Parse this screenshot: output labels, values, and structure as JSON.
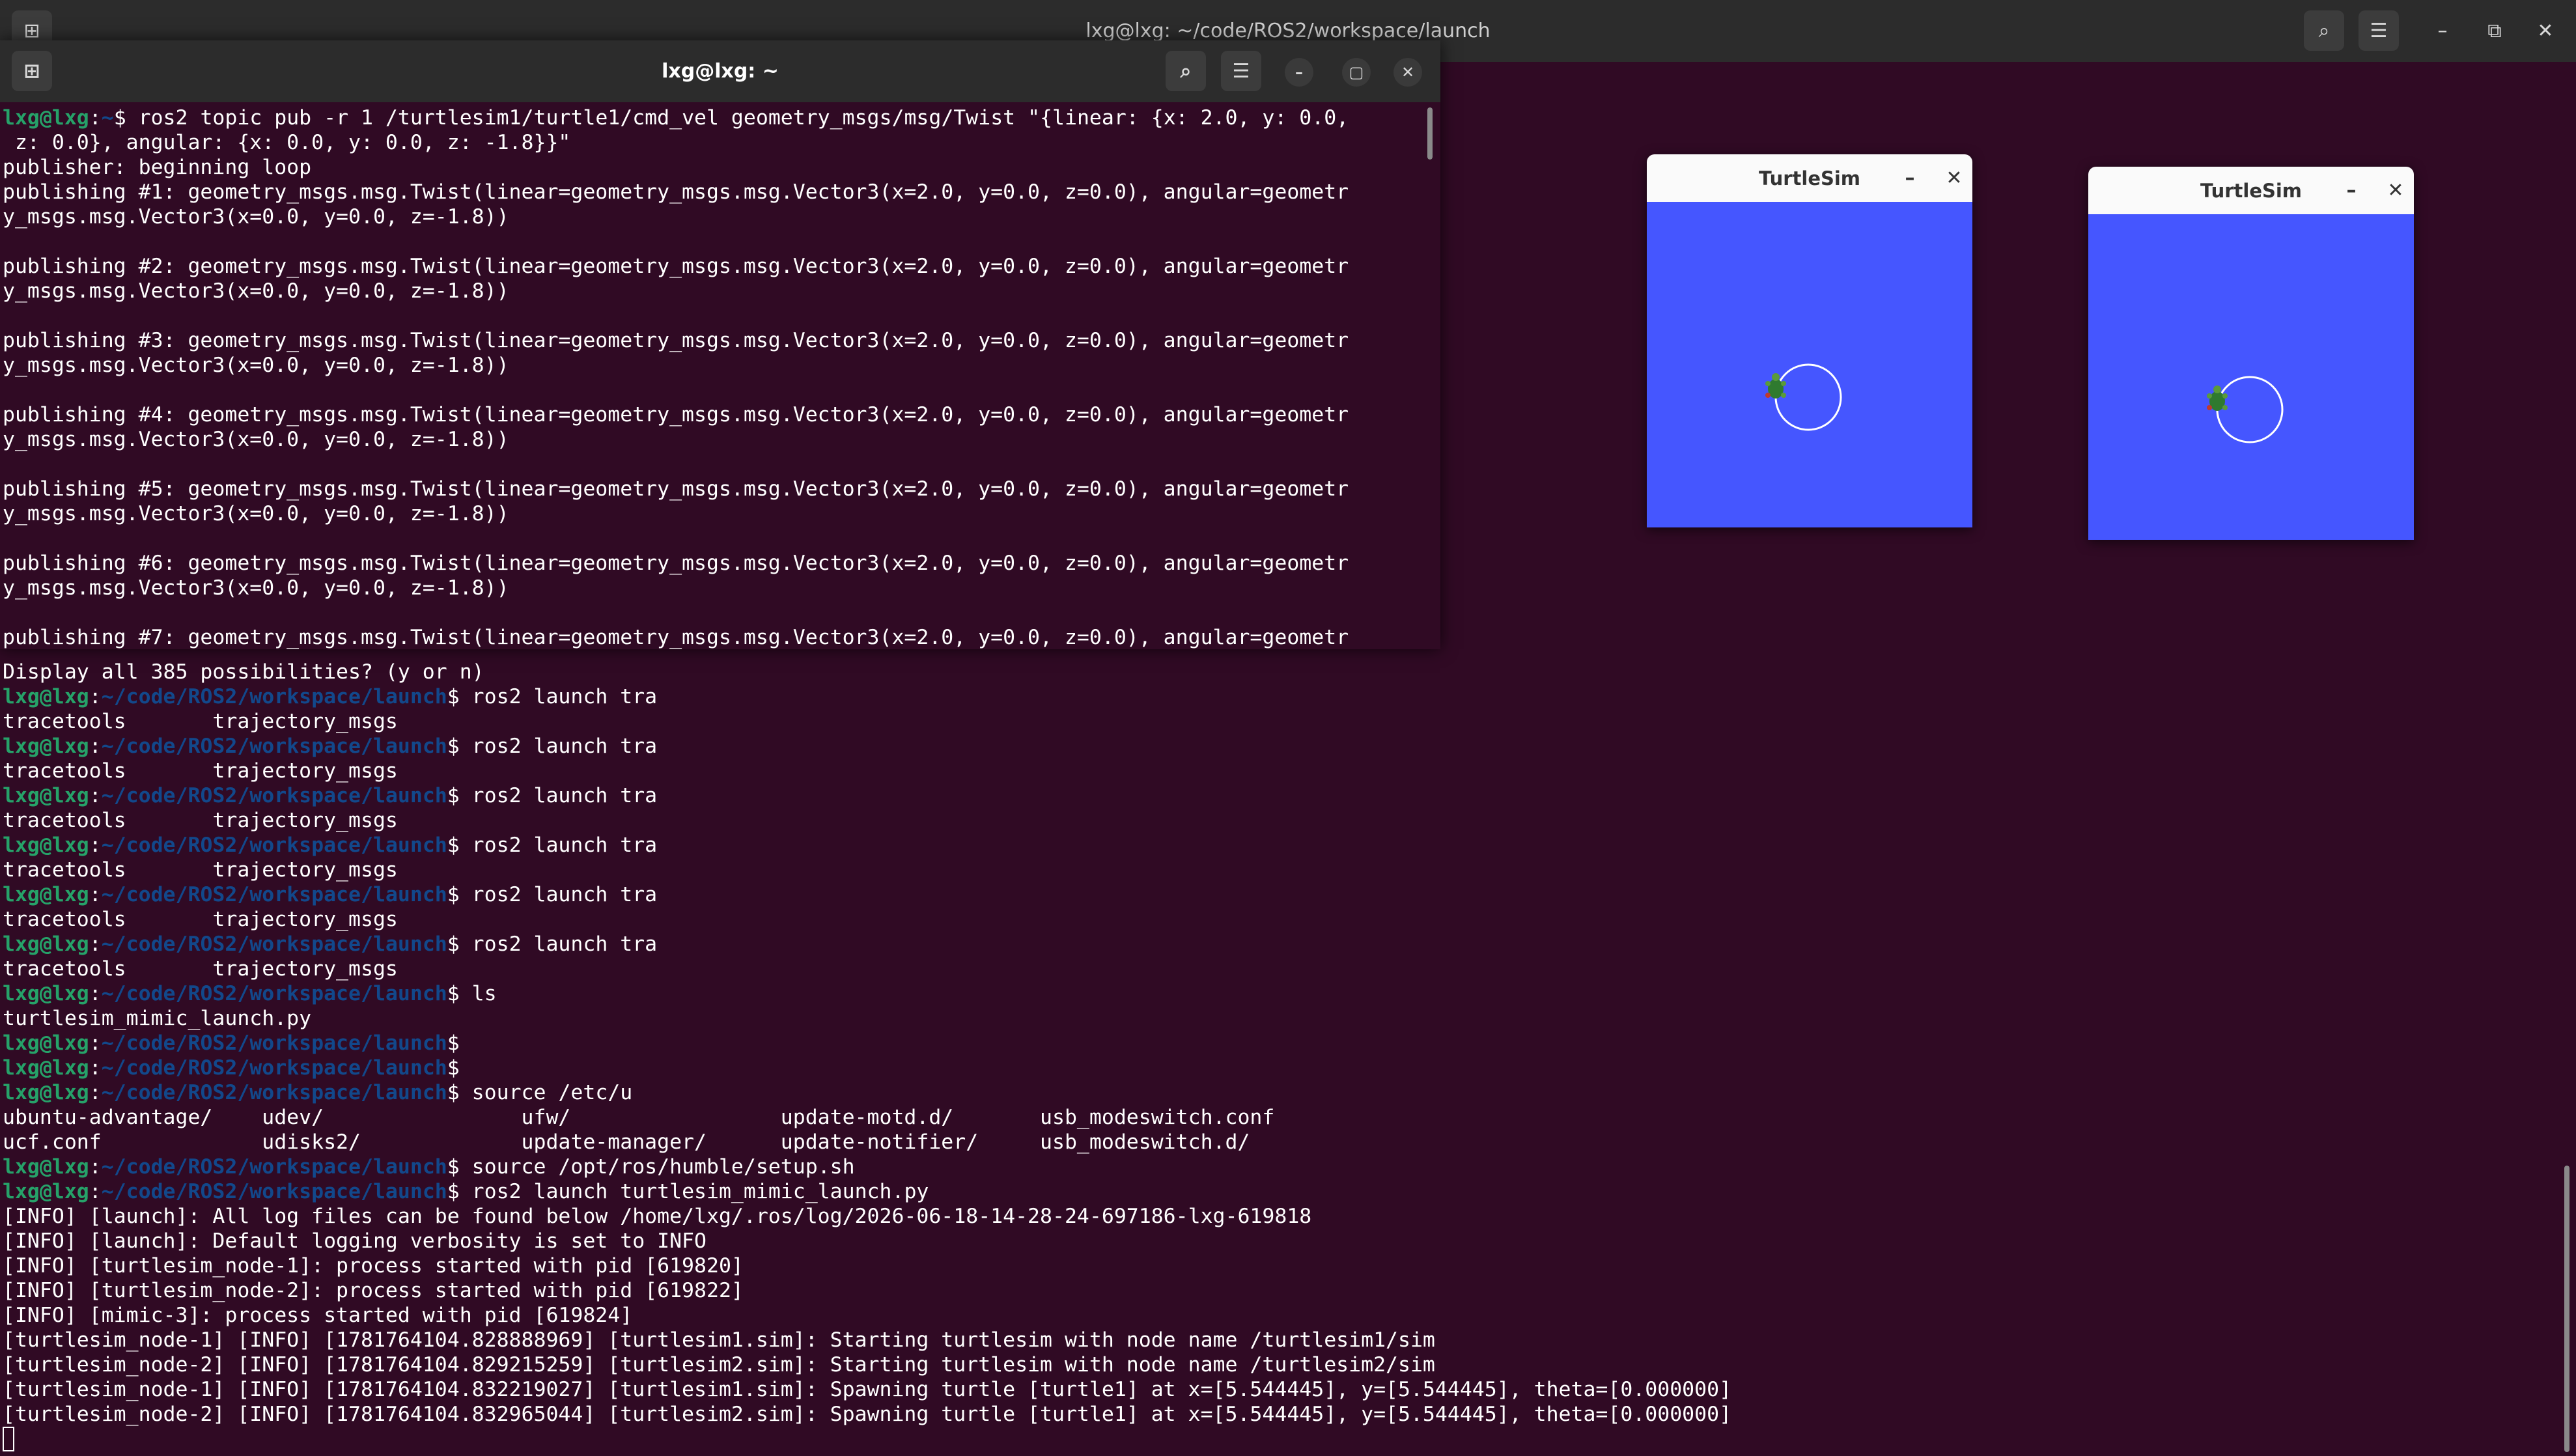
{
  "back_terminal": {
    "title": "lxg@lxg: ~/code/ROS2/workspace/launch",
    "new_tab_icon": "new-tab-icon",
    "lines": [
      {
        "type": "plain",
        "text": "Display all 385 possibilities? (y or n)"
      },
      {
        "type": "prompt",
        "user": "lxg@lxg",
        "path": "~/code/ROS2/workspace/launch",
        "cmd": "$ ros2 launch tra"
      },
      {
        "type": "plain",
        "text": "tracetools       trajectory_msgs"
      },
      {
        "type": "prompt",
        "user": "lxg@lxg",
        "path": "~/code/ROS2/workspace/launch",
        "cmd": "$ ros2 launch tra"
      },
      {
        "type": "plain",
        "text": "tracetools       trajectory_msgs"
      },
      {
        "type": "prompt",
        "user": "lxg@lxg",
        "path": "~/code/ROS2/workspace/launch",
        "cmd": "$ ros2 launch tra"
      },
      {
        "type": "plain",
        "text": "tracetools       trajectory_msgs"
      },
      {
        "type": "prompt",
        "user": "lxg@lxg",
        "path": "~/code/ROS2/workspace/launch",
        "cmd": "$ ros2 launch tra"
      },
      {
        "type": "plain",
        "text": "tracetools       trajectory_msgs"
      },
      {
        "type": "prompt",
        "user": "lxg@lxg",
        "path": "~/code/ROS2/workspace/launch",
        "cmd": "$ ros2 launch tra"
      },
      {
        "type": "plain",
        "text": "tracetools       trajectory_msgs"
      },
      {
        "type": "prompt",
        "user": "lxg@lxg",
        "path": "~/code/ROS2/workspace/launch",
        "cmd": "$ ros2 launch tra"
      },
      {
        "type": "plain",
        "text": "tracetools       trajectory_msgs"
      },
      {
        "type": "prompt",
        "user": "lxg@lxg",
        "path": "~/code/ROS2/workspace/launch",
        "cmd": "$ ls"
      },
      {
        "type": "plain",
        "text": "turtlesim_mimic_launch.py"
      },
      {
        "type": "prompt",
        "user": "lxg@lxg",
        "path": "~/code/ROS2/workspace/launch",
        "cmd": "$"
      },
      {
        "type": "prompt",
        "user": "lxg@lxg",
        "path": "~/code/ROS2/workspace/launch",
        "cmd": "$"
      },
      {
        "type": "prompt",
        "user": "lxg@lxg",
        "path": "~/code/ROS2/workspace/launch",
        "cmd": "$ source /etc/u"
      },
      {
        "type": "plain",
        "text": "ubuntu-advantage/    udev/                ufw/                 update-motd.d/       usb_modeswitch.conf"
      },
      {
        "type": "plain",
        "text": "ucf.conf             udisks2/             update-manager/      update-notifier/     usb_modeswitch.d/"
      },
      {
        "type": "prompt",
        "user": "lxg@lxg",
        "path": "~/code/ROS2/workspace/launch",
        "cmd": "$ source /opt/ros/humble/setup.sh"
      },
      {
        "type": "prompt",
        "user": "lxg@lxg",
        "path": "~/code/ROS2/workspace/launch",
        "cmd": "$ ros2 launch turtlesim_mimic_launch.py"
      },
      {
        "type": "plain",
        "text": "[INFO] [launch]: All log files can be found below /home/lxg/.ros/log/2026-06-18-14-28-24-697186-lxg-619818"
      },
      {
        "type": "plain",
        "text": "[INFO] [launch]: Default logging verbosity is set to INFO"
      },
      {
        "type": "plain",
        "text": "[INFO] [turtlesim_node-1]: process started with pid [619820]"
      },
      {
        "type": "plain",
        "text": "[INFO] [turtlesim_node-2]: process started with pid [619822]"
      },
      {
        "type": "plain",
        "text": "[INFO] [mimic-3]: process started with pid [619824]"
      },
      {
        "type": "plain",
        "text": "[turtlesim_node-1] [INFO] [1781764104.828888969] [turtlesim1.sim]: Starting turtlesim with node name /turtlesim1/sim"
      },
      {
        "type": "plain",
        "text": "[turtlesim_node-2] [INFO] [1781764104.829215259] [turtlesim2.sim]: Starting turtlesim with node name /turtlesim2/sim"
      },
      {
        "type": "plain",
        "text": "[turtlesim_node-1] [INFO] [1781764104.832219027] [turtlesim1.sim]: Spawning turtle [turtle1] at x=[5.544445], y=[5.544445], theta=[0.000000]"
      },
      {
        "type": "plain",
        "text": "[turtlesim_node-2] [INFO] [1781764104.832965044] [turtlesim2.sim]: Spawning turtle [turtle1] at x=[5.544445], y=[5.544445], theta=[0.000000]"
      },
      {
        "type": "cursor",
        "text": ""
      }
    ]
  },
  "front_terminal": {
    "title": "lxg@lxg: ~",
    "lines": [
      {
        "type": "prompt",
        "user": "lxg@lxg",
        "path": "~",
        "cmd": "$ ros2 topic pub -r 1 /turtlesim1/turtle1/cmd_vel geometry_msgs/msg/Twist \"{linear: {x: 2.0, y: 0.0,"
      },
      {
        "type": "plain",
        "text": " z: 0.0}, angular: {x: 0.0, y: 0.0, z: -1.8}}\""
      },
      {
        "type": "plain",
        "text": "publisher: beginning loop"
      },
      {
        "type": "plain",
        "text": "publishing #1: geometry_msgs.msg.Twist(linear=geometry_msgs.msg.Vector3(x=2.0, y=0.0, z=0.0), angular=geometr"
      },
      {
        "type": "plain",
        "text": "y_msgs.msg.Vector3(x=0.0, y=0.0, z=-1.8))"
      },
      {
        "type": "plain",
        "text": ""
      },
      {
        "type": "plain",
        "text": "publishing #2: geometry_msgs.msg.Twist(linear=geometry_msgs.msg.Vector3(x=2.0, y=0.0, z=0.0), angular=geometr"
      },
      {
        "type": "plain",
        "text": "y_msgs.msg.Vector3(x=0.0, y=0.0, z=-1.8))"
      },
      {
        "type": "plain",
        "text": ""
      },
      {
        "type": "plain",
        "text": "publishing #3: geometry_msgs.msg.Twist(linear=geometry_msgs.msg.Vector3(x=2.0, y=0.0, z=0.0), angular=geometr"
      },
      {
        "type": "plain",
        "text": "y_msgs.msg.Vector3(x=0.0, y=0.0, z=-1.8))"
      },
      {
        "type": "plain",
        "text": ""
      },
      {
        "type": "plain",
        "text": "publishing #4: geometry_msgs.msg.Twist(linear=geometry_msgs.msg.Vector3(x=2.0, y=0.0, z=0.0), angular=geometr"
      },
      {
        "type": "plain",
        "text": "y_msgs.msg.Vector3(x=0.0, y=0.0, z=-1.8))"
      },
      {
        "type": "plain",
        "text": ""
      },
      {
        "type": "plain",
        "text": "publishing #5: geometry_msgs.msg.Twist(linear=geometry_msgs.msg.Vector3(x=2.0, y=0.0, z=0.0), angular=geometr"
      },
      {
        "type": "plain",
        "text": "y_msgs.msg.Vector3(x=0.0, y=0.0, z=-1.8))"
      },
      {
        "type": "plain",
        "text": ""
      },
      {
        "type": "plain",
        "text": "publishing #6: geometry_msgs.msg.Twist(linear=geometry_msgs.msg.Vector3(x=2.0, y=0.0, z=0.0), angular=geometr"
      },
      {
        "type": "plain",
        "text": "y_msgs.msg.Vector3(x=0.0, y=0.0, z=-1.8))"
      },
      {
        "type": "plain",
        "text": ""
      },
      {
        "type": "plain",
        "text": "publishing #7: geometry_msgs.msg.Twist(linear=geometry_msgs.msg.Vector3(x=2.0, y=0.0, z=0.0), angular=geometr"
      }
    ]
  },
  "turtlesim_windows": [
    {
      "title": "TurtleSim",
      "minimize": "–",
      "close": "✕",
      "background": "#4556ff"
    },
    {
      "title": "TurtleSim",
      "minimize": "–",
      "close": "✕",
      "background": "#4556ff"
    }
  ],
  "icons": {
    "search": "⌕",
    "menu": "☰",
    "minimize": "–",
    "maximize": "▢",
    "restore": "⧉",
    "close": "✕",
    "new_tab": "⊞"
  },
  "colors": {
    "terminal_bg": "#300a24",
    "prompt_user": "#26a269",
    "prompt_path": "#12488b",
    "turtlesim_bg": "#4556ff"
  }
}
